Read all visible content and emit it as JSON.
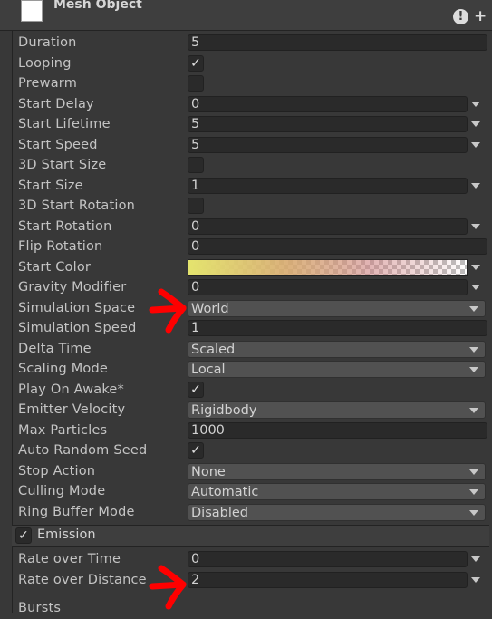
{
  "header": {
    "title": "Mesh Object"
  },
  "rows": [
    {
      "label": "Duration",
      "value": "5"
    },
    {
      "label": "Looping",
      "checked": true
    },
    {
      "label": "Prewarm",
      "checked": false
    },
    {
      "label": "Start Delay",
      "value": "0"
    },
    {
      "label": "Start Lifetime",
      "value": "5"
    },
    {
      "label": "Start Speed",
      "value": "5"
    },
    {
      "label": "3D Start Size",
      "checked": false
    },
    {
      "label": "Start Size",
      "value": "1"
    },
    {
      "label": "3D Start Rotation",
      "checked": false
    },
    {
      "label": "Start Rotation",
      "value": "0"
    },
    {
      "label": "Flip Rotation",
      "value": "0"
    },
    {
      "label": "Start Color"
    },
    {
      "label": "Gravity Modifier",
      "value": "0"
    },
    {
      "label": "Simulation Space",
      "value": "World"
    },
    {
      "label": "Simulation Speed",
      "value": "1"
    },
    {
      "label": "Delta Time",
      "value": "Scaled"
    },
    {
      "label": "Scaling Mode",
      "value": "Local"
    },
    {
      "label": "Play On Awake*",
      "checked": true
    },
    {
      "label": "Emitter Velocity",
      "value": "Rigidbody"
    },
    {
      "label": "Max Particles",
      "value": "1000"
    },
    {
      "label": "Auto Random Seed",
      "checked": true
    },
    {
      "label": "Stop Action",
      "value": "None"
    },
    {
      "label": "Culling Mode",
      "value": "Automatic"
    },
    {
      "label": "Ring Buffer Mode",
      "value": "Disabled"
    }
  ],
  "emission": {
    "label": "Emission",
    "checked": true,
    "rows": [
      {
        "label": "Rate over Time",
        "value": "0"
      },
      {
        "label": "Rate over Distance",
        "value": "2"
      },
      {
        "label": "Bursts"
      }
    ]
  },
  "check_glyph": "✓",
  "annotation_color": "#ff0000"
}
